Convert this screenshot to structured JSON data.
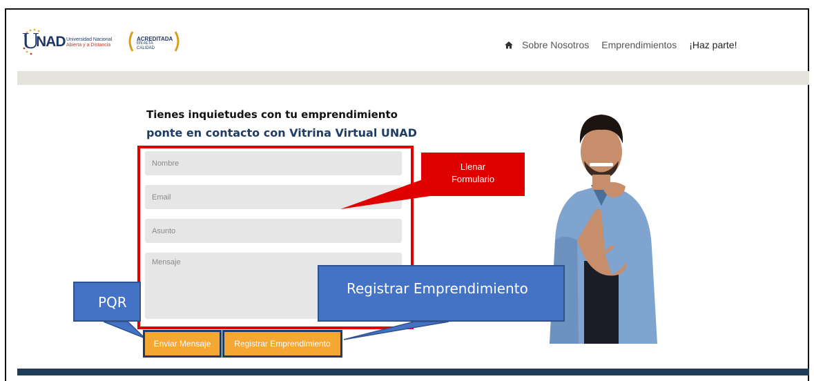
{
  "header": {
    "logo": {
      "letter_u": "U",
      "letters_nad": "NAD",
      "line1": "Universidad Nacional",
      "line2": "Abierta y a Distancia",
      "badge_title": "ACREDITADA",
      "badge_sub": "EN ALTA CALIDAD"
    },
    "nav": [
      {
        "icon": "home-icon"
      },
      {
        "label": "Sobre Nosotros"
      },
      {
        "label": "Emprendimientos"
      },
      {
        "label": "¡Haz parte!"
      }
    ]
  },
  "contact": {
    "heading": "Tienes inquietudes con tu emprendimiento",
    "subheading": "ponte en contacto con Vitrina Virtual UNAD",
    "fields": {
      "nombre_placeholder": "Nombre",
      "email_placeholder": "Email",
      "asunto_placeholder": "Asunto",
      "mensaje_placeholder": "Mensaje"
    },
    "buttons": {
      "enviar": "Enviar Mensaje",
      "registrar": "Registrar Emprendimiento"
    }
  },
  "annotations": {
    "llenar_line1": "Llenar",
    "llenar_line2": "Formulario",
    "registrar": "Registrar Emprendimiento",
    "pqr": "PQR"
  },
  "colors": {
    "accent_orange": "#f6a733",
    "annotation_red": "#e00000",
    "annotation_blue": "#4472c4",
    "brand_navy": "#1f3c64"
  }
}
